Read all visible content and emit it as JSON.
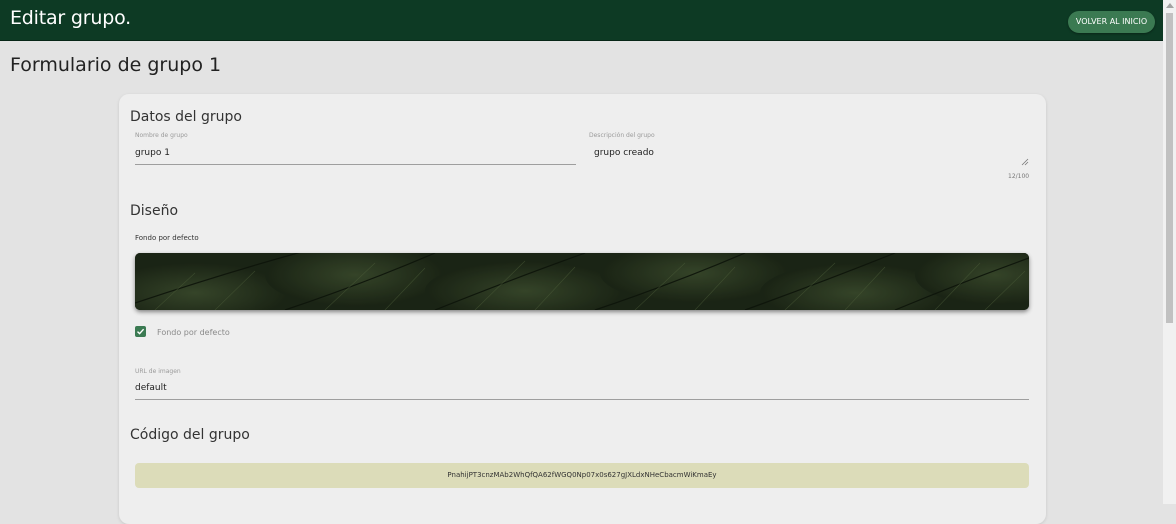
{
  "header": {
    "title": "Editar grupo.",
    "back_button_label": "VOLVER AL INICIO"
  },
  "page": {
    "title": "Formulario de grupo 1"
  },
  "group_data": {
    "section_title": "Datos del grupo",
    "name_label": "Nombre de grupo",
    "name_value": "grupo 1",
    "description_label": "Descripción del grupo",
    "description_value": "grupo creado",
    "description_counter": "12/100"
  },
  "design": {
    "section_title": "Diseño",
    "default_background_label": "Fondo por defecto",
    "checkbox_label": "Fondo por defecto",
    "checkbox_checked": true,
    "image_url_label": "URL de imagen",
    "image_url_value": "default"
  },
  "group_code": {
    "section_title": "Código del grupo",
    "code": "PnahijPT3cnzMAb2WhQfQA62fWGQ0Np07x0s627gJXLdxNHeCbacmWiKmaEy"
  },
  "colors": {
    "header_bg": "#0d3a24",
    "accent": "#3b7a52",
    "code_bg": "#dcdcb9"
  }
}
